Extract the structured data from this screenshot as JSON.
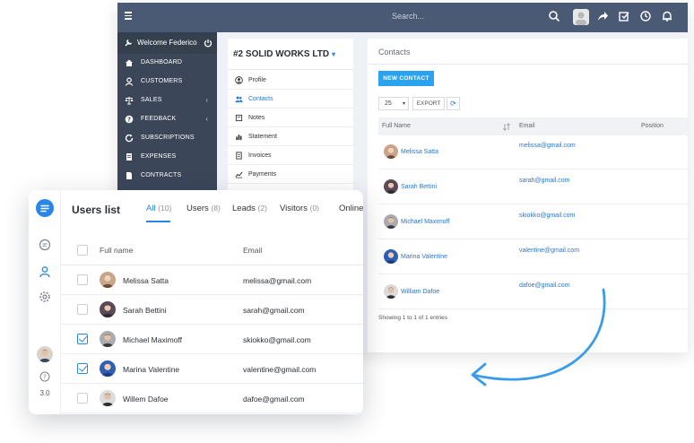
{
  "crm": {
    "search_placeholder": "Search...",
    "welcome": "Welcome Federico",
    "menu": [
      {
        "label": "DASHBOARD",
        "icon": "home-icon"
      },
      {
        "label": "CUSTOMERS",
        "icon": "user-icon"
      },
      {
        "label": "SALES",
        "icon": "scale-icon",
        "has_arrow": true
      },
      {
        "label": "FEEDBACK",
        "icon": "help-icon",
        "has_arrow": true
      },
      {
        "label": "SUBSCRIPTIONS",
        "icon": "refresh-icon"
      },
      {
        "label": "EXPENSES",
        "icon": "receipt-icon"
      },
      {
        "label": "CONTRACTS",
        "icon": "document-icon"
      }
    ],
    "company": "#2 SOLID WORKS LTD",
    "submenu": [
      {
        "label": "Profile",
        "icon": "user-circle-icon"
      },
      {
        "label": "Contacts",
        "icon": "contacts-icon",
        "active": true
      },
      {
        "label": "Notes",
        "icon": "note-icon"
      },
      {
        "label": "Statement",
        "icon": "chart-bar-icon"
      },
      {
        "label": "Invoices",
        "icon": "invoice-icon"
      },
      {
        "label": "Payments",
        "icon": "line-chart-icon"
      }
    ],
    "contacts": {
      "title": "Contacts",
      "new_button": "NEW CONTACT",
      "page_length": "25",
      "export_button": "EXPORT",
      "columns": [
        "Full Name",
        "Email",
        "Position"
      ],
      "rows": [
        {
          "name": "Melissa Satta",
          "email": "melissa@gmail.com"
        },
        {
          "name": "Sarah Bettini",
          "email": "sarah@gmail.com"
        },
        {
          "name": "Michael Maximoff",
          "email": "skiokko@gmail.com"
        },
        {
          "name": "Marina Valentine",
          "email": "valentine@gmail.com"
        },
        {
          "name": "William Dafoe",
          "email": "dafoe@gmail.com"
        }
      ],
      "footer": "Showing 1 to 1 of 1 entries"
    }
  },
  "users": {
    "title": "Users list",
    "tabs": [
      {
        "label": "All",
        "count": "(10)",
        "active": true
      },
      {
        "label": "Users",
        "count": "(8)"
      },
      {
        "label": "Leads",
        "count": "(2)"
      },
      {
        "label": "Visitors",
        "count": "(0)"
      },
      {
        "label": "Online",
        "count": ""
      }
    ],
    "columns": [
      "Full name",
      "Email"
    ],
    "rows": [
      {
        "name": "Melissa Satta",
        "email": "melissa@gmail.com",
        "checked": false
      },
      {
        "name": "Sarah Bettini",
        "email": "sarah@gmail.com",
        "checked": false
      },
      {
        "name": "Michael Maximoff",
        "email": "skiokko@gmail.com",
        "checked": true
      },
      {
        "name": "Marina Valentine",
        "email": "valentine@gmail.com",
        "checked": true
      },
      {
        "name": "Willem Dafoe",
        "email": "dafoe@gmail.com",
        "checked": false
      }
    ],
    "version": "3.0"
  },
  "colors": {
    "topbar": "#4a5a75",
    "sidebar": "#3b4659",
    "accent": "#29a3ef",
    "link": "#2a76c8",
    "primary": "#2a86e6"
  }
}
